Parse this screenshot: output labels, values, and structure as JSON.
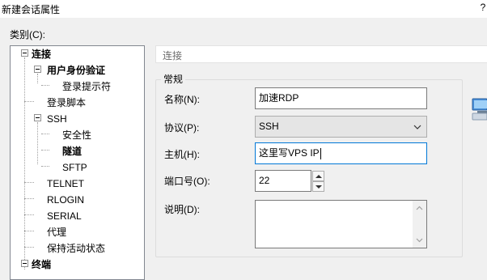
{
  "window": {
    "title": "新建会话属性",
    "help": "?"
  },
  "category_label": "类别(C):",
  "tree": [
    {
      "label": "连接",
      "bold": true
    },
    {
      "label": "用户身份验证",
      "bold": true
    },
    {
      "label": "登录提示符",
      "bold": false
    },
    {
      "label": "登录脚本",
      "bold": false
    },
    {
      "label": "SSH",
      "bold": false
    },
    {
      "label": "安全性",
      "bold": false
    },
    {
      "label": "隧道",
      "bold": true
    },
    {
      "label": "SFTP",
      "bold": false
    },
    {
      "label": "TELNET",
      "bold": false
    },
    {
      "label": "RLOGIN",
      "bold": false
    },
    {
      "label": "SERIAL",
      "bold": false
    },
    {
      "label": "代理",
      "bold": false
    },
    {
      "label": "保持活动状态",
      "bold": false
    },
    {
      "label": "终端",
      "bold": true
    }
  ],
  "panel": {
    "header": "连接",
    "group_title": "常规"
  },
  "fields": {
    "name": {
      "label": "名称(N):",
      "value": "加速RDP"
    },
    "protocol": {
      "label": "协议(P):",
      "value": "SSH"
    },
    "host": {
      "label": "主机(H):",
      "value": "这里写VPS IP"
    },
    "port": {
      "label": "端口号(O):",
      "value": "22"
    },
    "description": {
      "label": "说明(D):",
      "value": ""
    }
  },
  "colors": {
    "focus_border": "#0078d7",
    "tree_border": "#828790",
    "window_bg": "#f0f0f0"
  },
  "icons": [
    "help-icon",
    "toggle-collapse-icon",
    "chevron-down-icon",
    "spin-up-icon",
    "spin-down-icon",
    "scroll-up-icon",
    "scroll-down-icon",
    "network-computer-icon"
  ]
}
